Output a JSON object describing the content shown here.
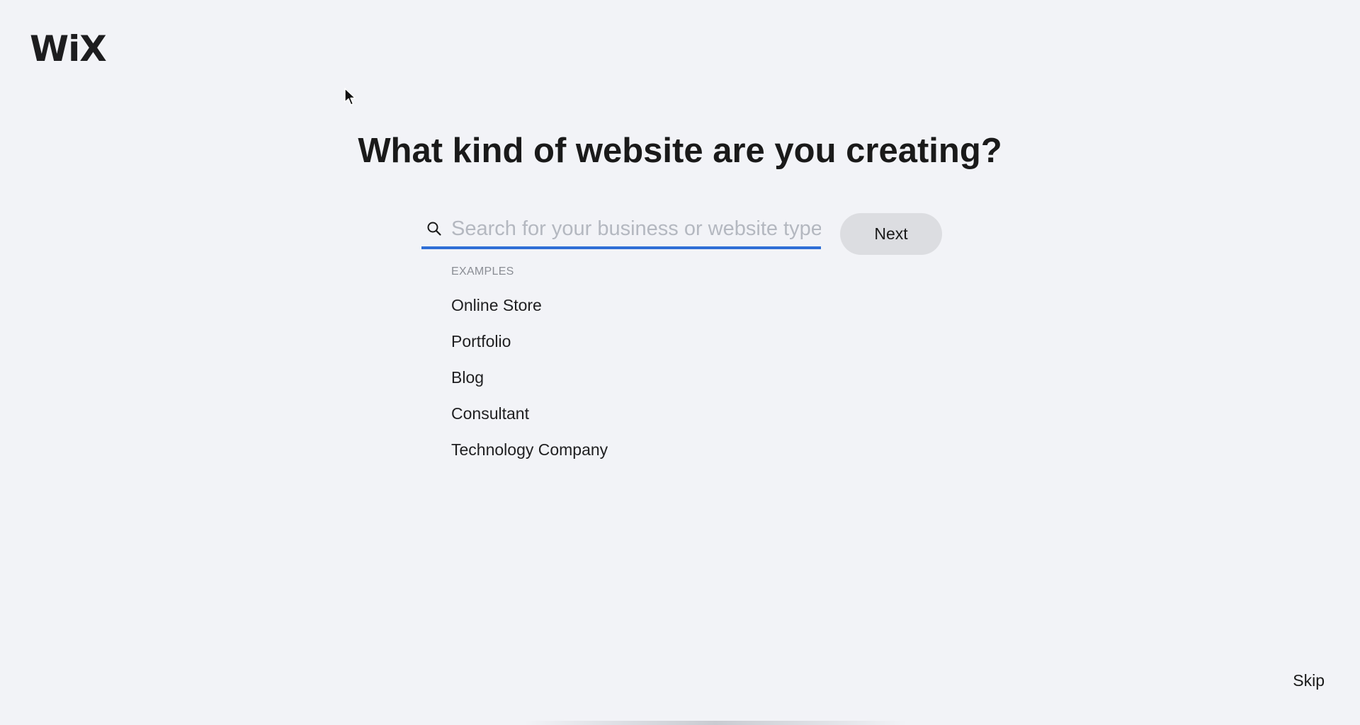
{
  "logo": {
    "text": "WiX"
  },
  "heading": "What kind of website are you creating?",
  "search": {
    "placeholder": "Search for your business or website type",
    "value": "",
    "accent_color": "#2f6fd6"
  },
  "next_button": {
    "label": "Next"
  },
  "examples": {
    "label": "EXAMPLES",
    "items": [
      "Online Store",
      "Portfolio",
      "Blog",
      "Consultant",
      "Technology Company"
    ]
  },
  "skip": {
    "label": "Skip"
  },
  "icons": {
    "search": "search-icon",
    "cursor": "mouse-pointer-icon"
  }
}
